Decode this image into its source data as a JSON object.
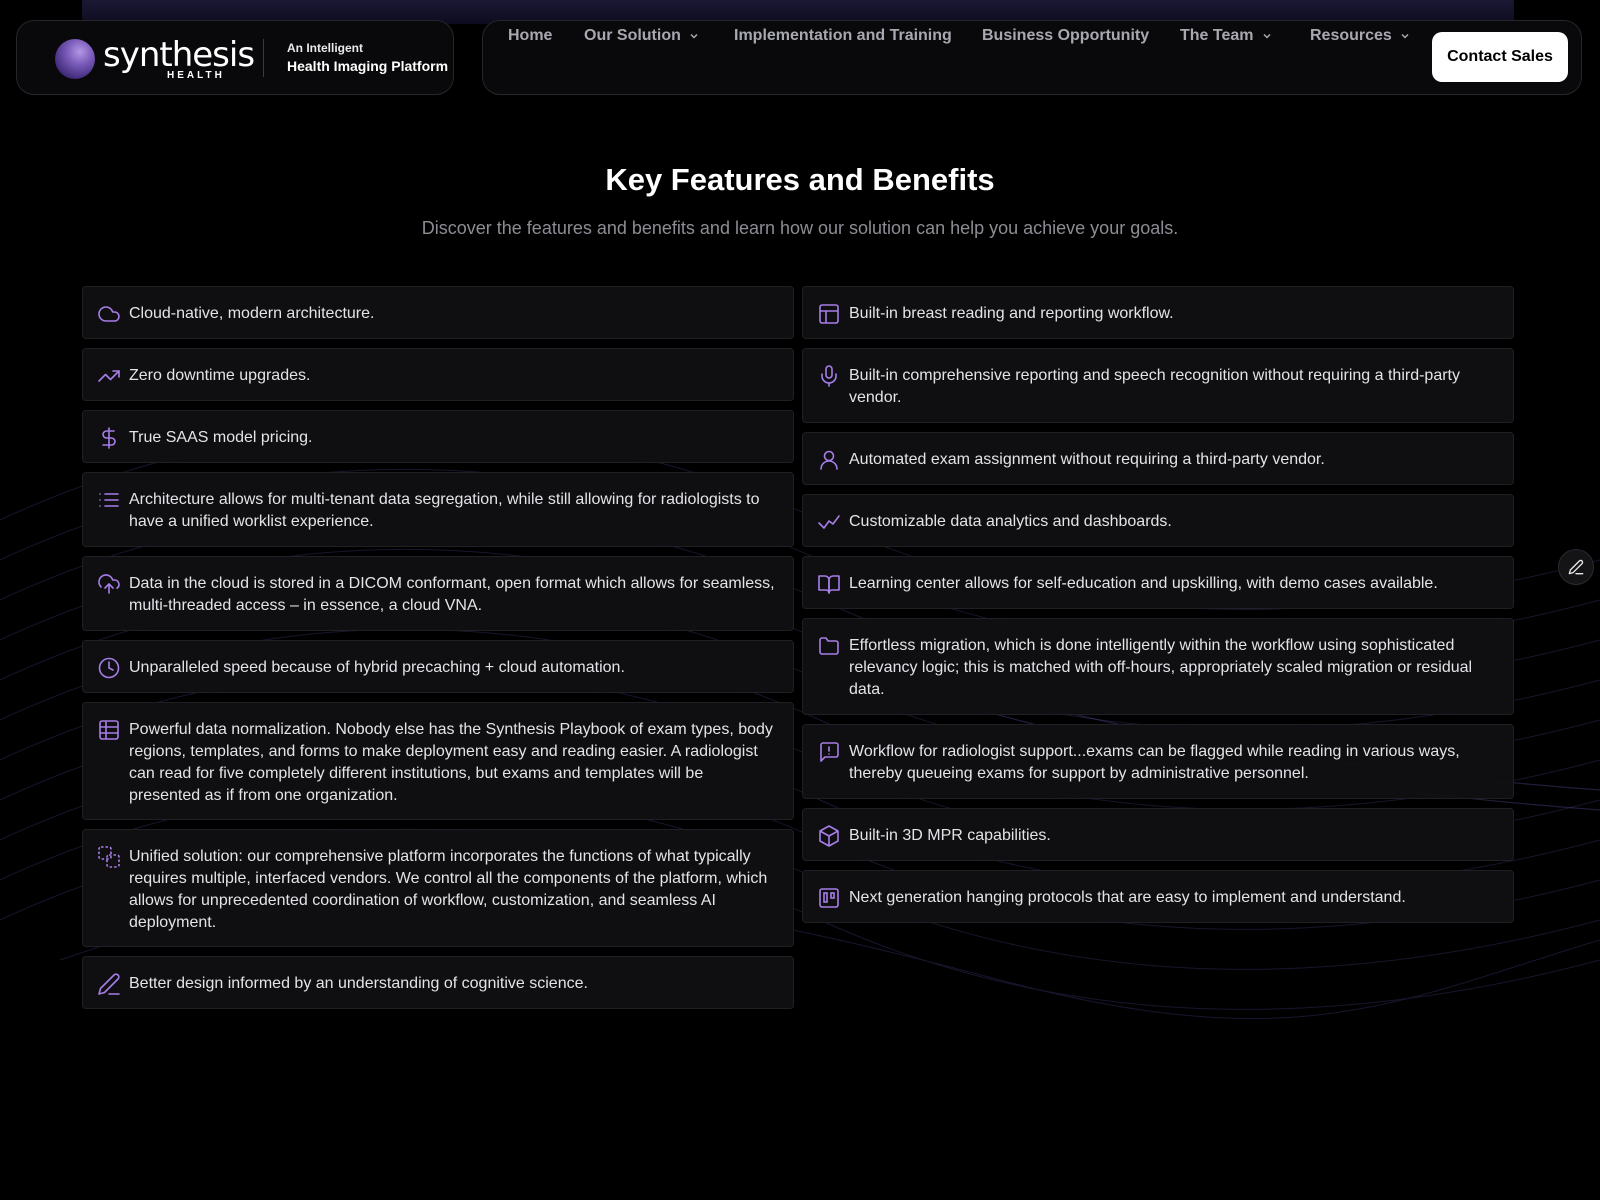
{
  "brand": {
    "name": "synthesis",
    "sub": "HEALTH",
    "tagline_line1": "An Intelligent",
    "tagline_line2": "Health Imaging Platform"
  },
  "nav": {
    "items": [
      {
        "label": "Home"
      },
      {
        "label": "Our Solution"
      },
      {
        "label": "Implementation and Training"
      },
      {
        "label": "Business Opportunity"
      },
      {
        "label": "The Team"
      },
      {
        "label": "Resources"
      }
    ],
    "contact_label": "Contact Sales"
  },
  "section": {
    "title": "Key Features and Benefits",
    "subtitle": "Discover the features and benefits and learn how our solution can help you achieve your goals."
  },
  "features_left": [
    {
      "icon": "cloud-icon",
      "text": "Cloud-native, modern architecture."
    },
    {
      "icon": "trending-up-icon",
      "text": "Zero downtime upgrades."
    },
    {
      "icon": "dollar-icon",
      "text": "True SAAS model pricing."
    },
    {
      "icon": "list-icon",
      "text": "Architecture allows for multi-tenant data segregation, while still allowing for radiologists to have a unified worklist experience."
    },
    {
      "icon": "cloud-upload-icon",
      "text": "Data in the cloud is stored in a DICOM conformant, open format which allows for seamless, multi-threaded access – in essence, a cloud VNA."
    },
    {
      "icon": "clock-icon",
      "text": "Unparalleled speed because of hybrid precaching + cloud automation."
    },
    {
      "icon": "table-icon",
      "text": "Powerful data normalization. Nobody else has the Synthesis Playbook of exam types, body regions, templates, and forms to make deployment easy and reading easier. A radiologist can read for five completely different institutions, but exams and templates will be presented as if from one organization."
    },
    {
      "icon": "combine-icon",
      "text": "Unified solution: our comprehensive platform incorporates the functions of what typically requires multiple, interfaced vendors. We control all the components of the platform, which allows for unprecedented coordination of workflow, customization, and seamless AI deployment."
    },
    {
      "icon": "pencil-icon",
      "text": "Better design informed by an understanding of cognitive science."
    }
  ],
  "features_right": [
    {
      "icon": "layout-icon",
      "text": "Built-in breast reading and reporting workflow."
    },
    {
      "icon": "microphone-icon",
      "text": "Built-in comprehensive reporting and speech recognition without requiring a third-party vendor."
    },
    {
      "icon": "user-icon",
      "text": "Automated exam assignment without requiring a third-party vendor."
    },
    {
      "icon": "check-chart-icon",
      "text": "Customizable data analytics and dashboards."
    },
    {
      "icon": "book-icon",
      "text": "Learning center allows for self-education and upskilling, with demo cases available."
    },
    {
      "icon": "folder-icon",
      "text": "Effortless migration, which is done intelligently within the workflow using sophisticated relevancy logic; this is matched with off-hours, appropriately scaled migration or residual data."
    },
    {
      "icon": "message-alert-icon",
      "text": "Workflow for radiologist support...exams can be flagged while reading in various ways, thereby queueing exams for support by administrative personnel."
    },
    {
      "icon": "box-icon",
      "text": "Built-in 3D MPR capabilities."
    },
    {
      "icon": "kanban-icon",
      "text": "Next generation hanging protocols that are easy to implement and understand."
    }
  ],
  "colors": {
    "accent": "#a77ee8",
    "background": "#000000",
    "card": "#101013",
    "muted_text": "#8c8c94"
  }
}
